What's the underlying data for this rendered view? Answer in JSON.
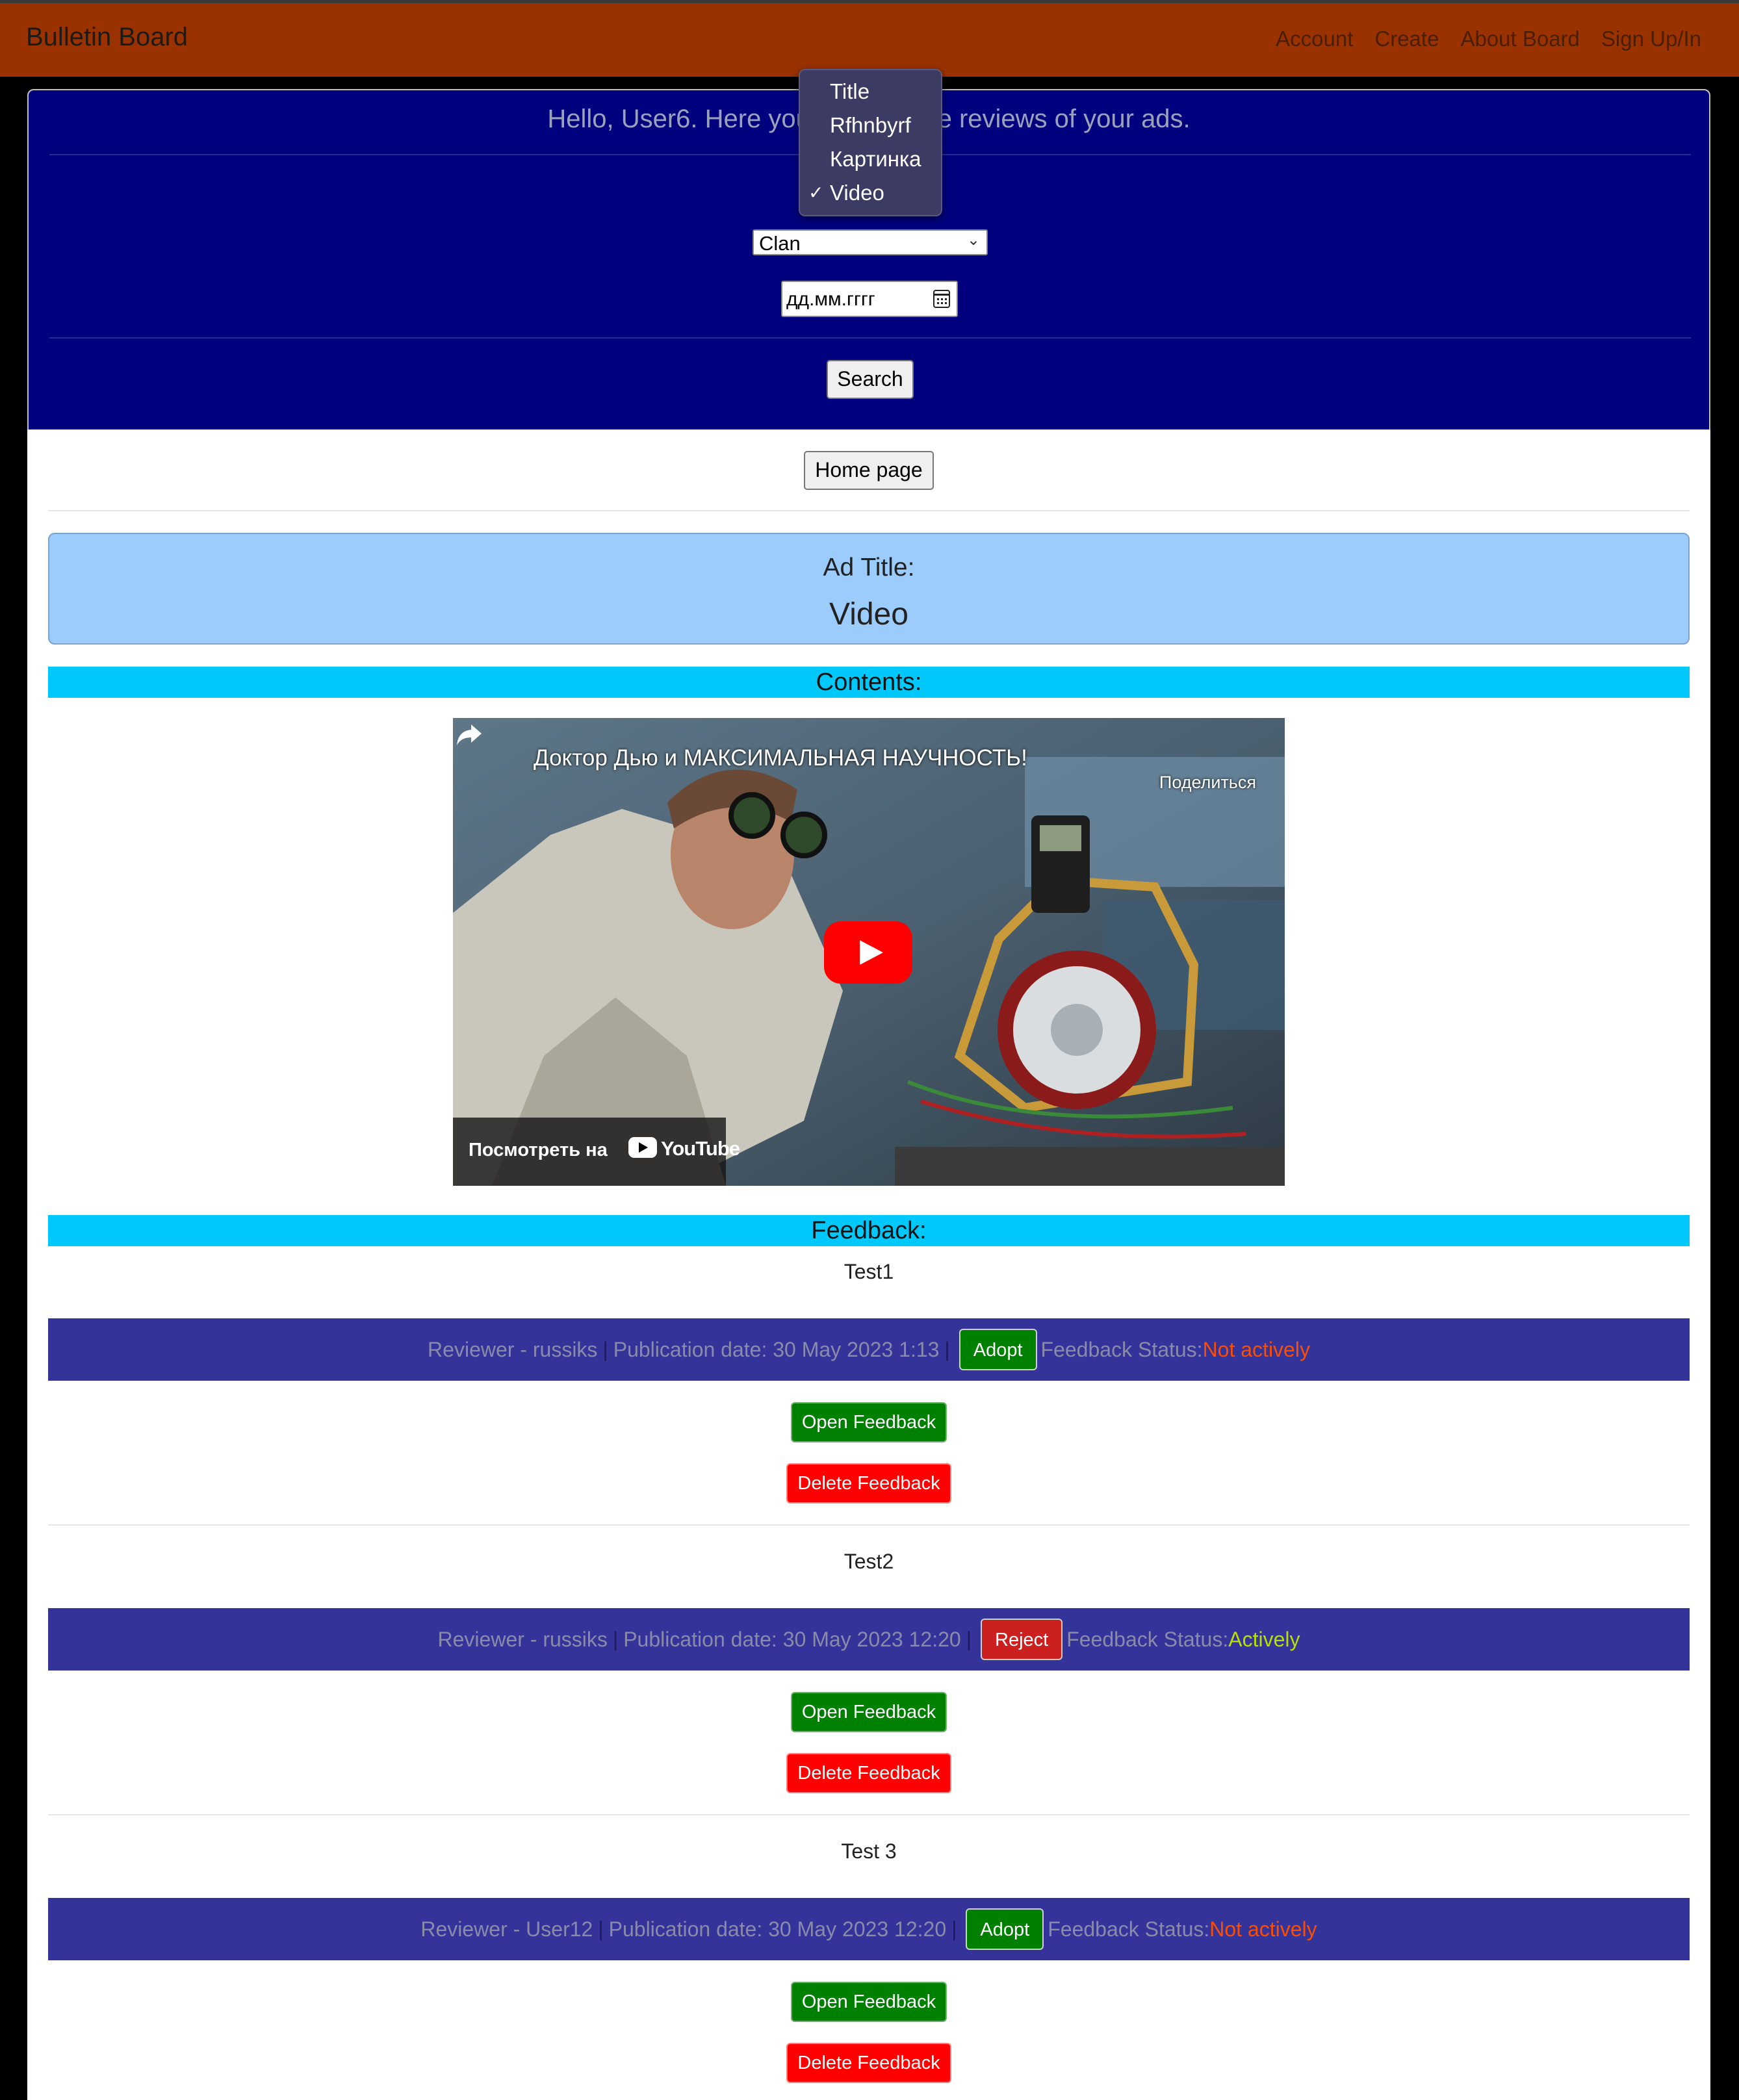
{
  "navbar": {
    "brand": "Bulletin Board",
    "links": [
      "Account",
      "Create",
      "About Board",
      "Sign Up/In"
    ]
  },
  "header": {
    "greeting": "Hello, User6. Here you can see the reviews of your ads."
  },
  "filters": {
    "select_value": "Clan",
    "date_placeholder": "дд.мм.гггг",
    "search_label": "Search"
  },
  "dropdown": {
    "options": [
      "Title",
      "Rfhnbyrf",
      "Картинка",
      "Video"
    ],
    "selected": "Video"
  },
  "home_button": "Home page",
  "ad": {
    "label": "Ad Title:",
    "title": "Video",
    "contents_label": "Contents:",
    "feedback_label": "Feedback:"
  },
  "video": {
    "title": "Доктор Дью и МАКСИМАЛЬНАЯ НАУЧНОСТЬ!",
    "share_label": "Поделиться",
    "watch_on": "Посмотреть на",
    "platform": "YouTube"
  },
  "feedback": [
    {
      "text": "Test1",
      "reviewer": "Reviewer - russiks",
      "date": "Publication date: 30 May 2023 1:13",
      "action": "Adopt",
      "status_label": "Feedback Status:",
      "status": "Not actively"
    },
    {
      "text": "Test2",
      "reviewer": "Reviewer - russiks",
      "date": "Publication date: 30 May 2023 12:20",
      "action": "Reject",
      "status_label": "Feedback Status: ",
      "status": "Actively"
    },
    {
      "text": "Test 3",
      "reviewer": "Reviewer - User12",
      "date": "Publication date: 30 May 2023 12:20",
      "action": "Adopt",
      "status_label": "Feedback Status:",
      "status": "Not actively"
    }
  ],
  "buttons": {
    "open": "Open Feedback",
    "delete": "Delete Feedback"
  },
  "colors": {
    "navbar": "#9a3200",
    "header_bg": "#00007f",
    "ad_box": "#9cccfb",
    "section_bar": "#00c8fb",
    "feedback_bar": "#333399",
    "adopt": "#008000",
    "reject": "#cc2020",
    "status_inactive": "#ff4d00",
    "status_active": "#b8e000"
  }
}
